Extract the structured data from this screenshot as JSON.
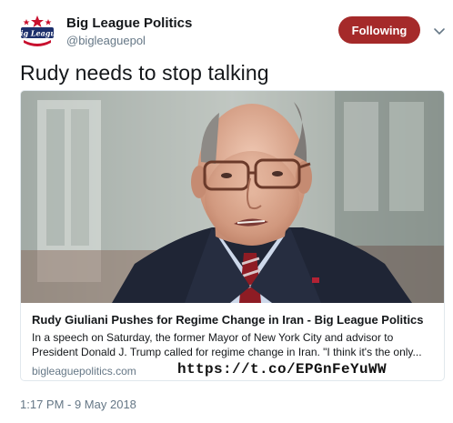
{
  "account": {
    "display_name": "Big League Politics",
    "handle": "@bigleaguepol",
    "avatar_icon": "big-league-politics-logo",
    "logo_text": "Big League"
  },
  "follow_button": {
    "label": "Following",
    "color": "#a52a2a"
  },
  "menu": {
    "icon": "chevron-down-icon"
  },
  "tweet": {
    "text": "Rudy needs to stop talking"
  },
  "card": {
    "image_alt": "Photo of Rudy Giuliani",
    "title": "Rudy Giuliani Pushes for Regime Change in Iran - Big League Politics",
    "description": "In a speech on Saturday, the former Mayor of New York City and advisor to President Donald J. Trump called for regime change in Iran. \"I think it's the only...",
    "domain": "bigleaguepolitics.com"
  },
  "short_url": "https://t.co/EPGnFeYuWW",
  "timestamp": "1:17 PM - 9 May 2018"
}
